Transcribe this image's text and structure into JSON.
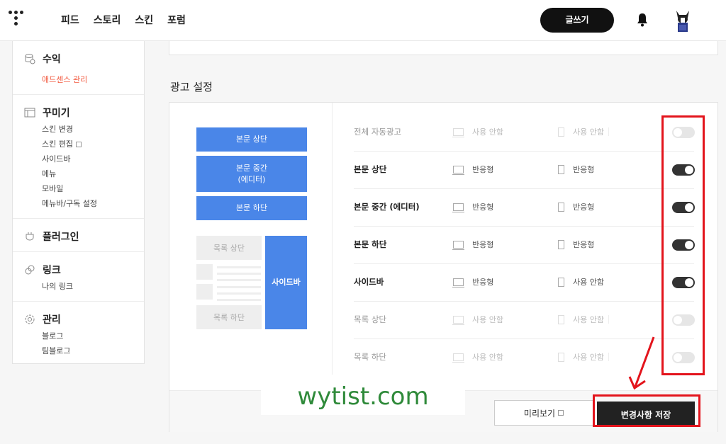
{
  "nav": {
    "links": [
      "피드",
      "스토리",
      "스킨",
      "포럼"
    ],
    "write_label": "글쓰기"
  },
  "sidebar": {
    "groups": [
      {
        "title": "수익",
        "icon": "coins-icon",
        "items": [
          "애드센스 관리"
        ]
      },
      {
        "title": "꾸미기",
        "icon": "layout-icon",
        "items": [
          "스킨 변경",
          "스킨 편집",
          "사이드바",
          "메뉴",
          "모바일",
          "메뉴바/구독 설정"
        ]
      },
      {
        "title": "플러그인",
        "icon": "plug-icon",
        "items": []
      },
      {
        "title": "링크",
        "icon": "link-icon",
        "items": [
          "나의 링크"
        ]
      },
      {
        "title": "관리",
        "icon": "gear-icon",
        "items": [
          "블로그",
          "팀블로그"
        ]
      }
    ]
  },
  "main": {
    "section_title": "광고 설정",
    "diagram": {
      "top": "본문 상단",
      "middle_line1": "본문 중간",
      "middle_line2": "(에디터)",
      "bottom": "본문 하단",
      "list_top": "목록 상단",
      "list_bottom": "목록 하단",
      "sidebar": "사이드바"
    },
    "rows": [
      {
        "label": "전체 자동광고",
        "pc": "사용 안함",
        "mobile": "사용 안함",
        "enabled": false
      },
      {
        "label": "본문 상단",
        "pc": "반응형",
        "mobile": "반응형",
        "enabled": true
      },
      {
        "label": "본문 중간 (에디터)",
        "pc": "반응형",
        "mobile": "반응형",
        "enabled": true
      },
      {
        "label": "본문 하단",
        "pc": "반응형",
        "mobile": "반응형",
        "enabled": true
      },
      {
        "label": "사이드바",
        "pc": "반응형",
        "mobile": "사용 안함",
        "enabled": true
      },
      {
        "label": "목록 상단",
        "pc": "사용 안함",
        "mobile": "사용 안함",
        "enabled": false
      },
      {
        "label": "목록 하단",
        "pc": "사용 안함",
        "mobile": "사용 안함",
        "enabled": false
      }
    ],
    "preview_label": "미리보기",
    "save_label": "변경사항 저장"
  },
  "watermark": "wytist.com",
  "colors": {
    "accent": "#4a86e8",
    "active_menu": "#f2583e",
    "highlight": "#e3141c",
    "watermark": "#2f8a3a"
  }
}
